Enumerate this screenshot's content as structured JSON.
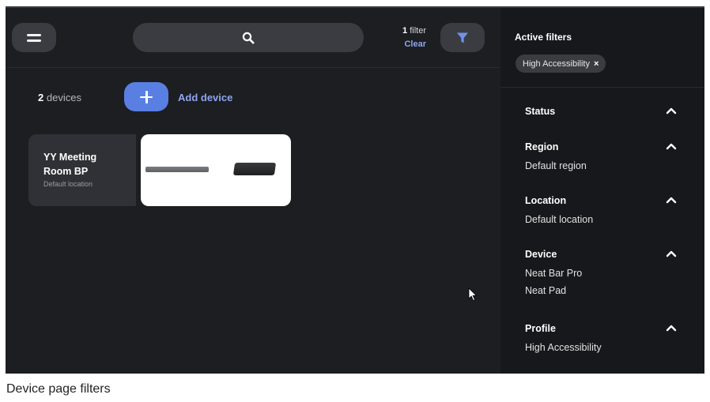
{
  "topbar": {
    "filter_count_number": "1",
    "filter_count_word": "filter",
    "clear_label": "Clear"
  },
  "devices": {
    "count_number": "2",
    "count_word": "devices",
    "add_label": "Add device",
    "items": [
      {
        "name": "YY Meeting Room BP",
        "location": "Default location"
      }
    ]
  },
  "filters_panel": {
    "title": "Active filters",
    "active_chips": [
      {
        "label": "High Accessibility",
        "remove": "×"
      }
    ],
    "sections": [
      {
        "title": "Status",
        "options": []
      },
      {
        "title": "Region",
        "options": [
          "Default region"
        ]
      },
      {
        "title": "Location",
        "options": [
          "Default location"
        ]
      },
      {
        "title": "Device",
        "options": [
          "Neat Bar Pro",
          "Neat Pad"
        ]
      },
      {
        "title": "Profile",
        "options": [
          "High Accessibility"
        ]
      }
    ]
  },
  "caption": "Device page filters",
  "icons": {
    "menu": "hamburger-menu-icon",
    "search": "search-icon",
    "filter": "funnel-filter-icon",
    "add": "plus-icon",
    "chevron": "chevron-up-icon"
  },
  "colors": {
    "app_bg": "#1d1e22",
    "panel_bg": "#17181b",
    "control_bg": "#3b3c41",
    "accent": "#5a7fe3",
    "link": "#8da5ef",
    "filter_icon": "#6f92ee"
  }
}
